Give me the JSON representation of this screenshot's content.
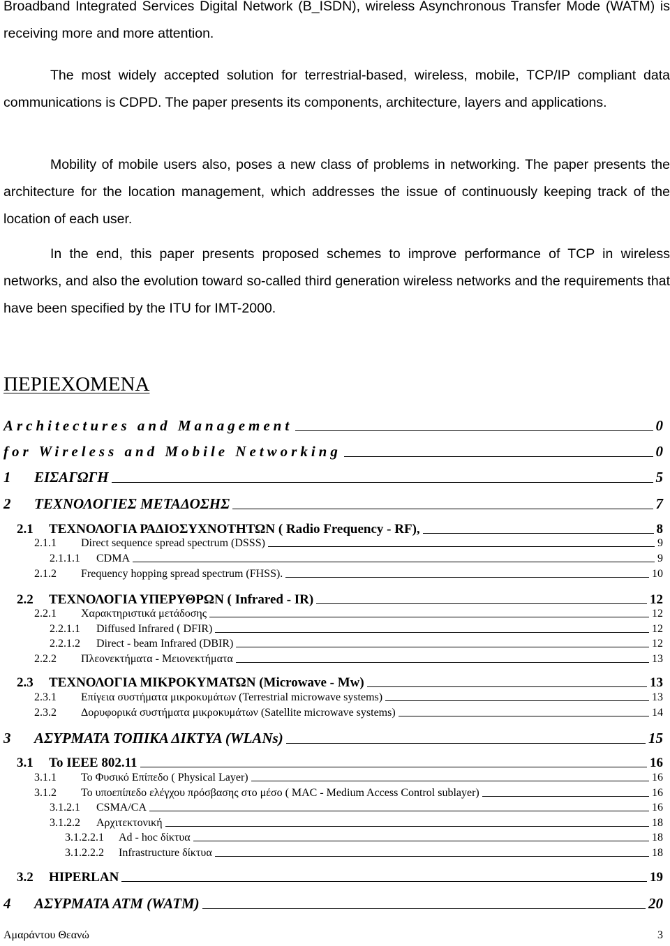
{
  "paragraphs": [
    {
      "text": "Broadband Integrated Services Digital Network (B_ISDN), wireless Asynchronous Transfer Mode (WATM) is receiving more and more attention.",
      "indent": false
    },
    {
      "text": "The most widely accepted solution for terrestrial-based, wireless, mobile, TCP/IP compliant data communications is CDPD. The paper presents its components, architecture, layers and applications.",
      "indent": true
    },
    {
      "text": "Mobility of mobile users also, poses a new class of problems in networking. The paper presents the architecture for the location management, which addresses the issue of continuously keeping track of the location of each user.",
      "indent": true
    },
    {
      "text": "In the end, this paper presents proposed schemes to improve performance of TCP in wireless networks, and also the evolution toward so-called third generation wireless networks and the requirements that have been specified by the ITU for IMT-2000.",
      "indent": true
    }
  ],
  "toc": {
    "title": "ΠΕΡΙΕΧΟΜΕΝΑ",
    "entries": [
      {
        "num": "",
        "label": "Architectures and Management",
        "page": "0",
        "level": 0
      },
      {
        "num": "",
        "label": "for Wireless and Mobile Networking",
        "page": "0",
        "level": 0
      },
      {
        "num": "1",
        "label": "ΕΙΣΑΓΩΓΗ",
        "page": "5",
        "level": 1
      },
      {
        "num": "2",
        "label": "ΤΕΧΝΟΛΟΓΙΕΣ ΜΕΤΑΔΟΣΗΣ",
        "page": "7",
        "level": 1
      },
      {
        "num": "2.1",
        "label": "ΤΕΧΝΟΛΟΓΙΑ ΡΑΔΙΟΣΥΧΝΟΤΗΤΩΝ ( Radio Frequency - RF),",
        "page": "8",
        "level": 2
      },
      {
        "num": "2.1.1",
        "label": "Direct sequence spread spectrum (DSSS)",
        "page": "9",
        "level": 3
      },
      {
        "num": "2.1.1.1",
        "label": "CDMA",
        "page": "9",
        "level": 4
      },
      {
        "num": "2.1.2",
        "label": "Frequency hopping spread spectrum (FHSS).",
        "page": "10",
        "level": 3
      },
      {
        "num": "2.2",
        "label": "ΤΕΧΝΟΛΟΓΙΑ ΥΠΕΡΥΘΡΩΝ ( Infrared - IR)",
        "page": "12",
        "level": 2
      },
      {
        "num": "2.2.1",
        "label": "Χαρακτηριστικά μετάδοσης",
        "page": "12",
        "level": 3
      },
      {
        "num": "2.2.1.1",
        "label": "Diffused Infrared ( DFIR)",
        "page": "12",
        "level": 4
      },
      {
        "num": "2.2.1.2",
        "label": "Direct -  beam Infrared (DBIR)",
        "page": "12",
        "level": 4
      },
      {
        "num": "2.2.2",
        "label": "Πλεονεκτήματα - Μειονεκτήματα",
        "page": "13",
        "level": 3
      },
      {
        "num": "2.3",
        "label": "ΤΕΧΝΟΛΟΓΙΑ ΜΙΚΡΟΚΥΜΑΤΩΝ  (Microwave - Mw)",
        "page": "13",
        "level": 2
      },
      {
        "num": "2.3.1",
        "label": "Επίγεια συστήματα μικροκυμάτων (Terrestrial microwave systems)",
        "page": "13",
        "level": 3
      },
      {
        "num": "2.3.2",
        "label": "Δορυφορικά συστήματα μικροκυμάτων (Satellite microwave systems)",
        "page": "14",
        "level": 3
      },
      {
        "num": "3",
        "label": "ΑΣΥΡΜΑΤΑ ΤΟΠΙΚΑ ΔΙΚΤΥΑ (WLANs)",
        "page": "15",
        "level": 1
      },
      {
        "num": "3.1",
        "label": "Το IEEE 802.11",
        "page": "16",
        "level": 2
      },
      {
        "num": "3.1.1",
        "label": "Το Φυσικό Επίπεδο ( Physical Layer)",
        "page": "16",
        "level": 3
      },
      {
        "num": "3.1.2",
        "label": "Το υποεπίπεδο ελέγχου πρόσβασης στο μέσο ( MAC - Medium Access Control sublayer)",
        "page": "16",
        "level": 3
      },
      {
        "num": "3.1.2.1",
        "label": "CSMA/CA",
        "page": "16",
        "level": 4
      },
      {
        "num": "3.1.2.2",
        "label": "Αρχιτεκτονική",
        "page": "18",
        "level": 4
      },
      {
        "num": "3.1.2.2.1",
        "label": "Ad - hoc δίκτυα",
        "page": "18",
        "level": 5
      },
      {
        "num": "3.1.2.2.2",
        "label": "Infrastructure δίκτυα",
        "page": "18",
        "level": 5
      },
      {
        "num": "3.2",
        "label": "HIPERLAN",
        "page": "19",
        "level": 2
      },
      {
        "num": "4",
        "label": "ΑΣΥΡΜΑΤΑ ΑΤΜ (WATM)",
        "page": "20",
        "level": 1
      }
    ]
  },
  "footer": {
    "author": "Αμαράντου Θεανώ",
    "page_number": "3"
  }
}
